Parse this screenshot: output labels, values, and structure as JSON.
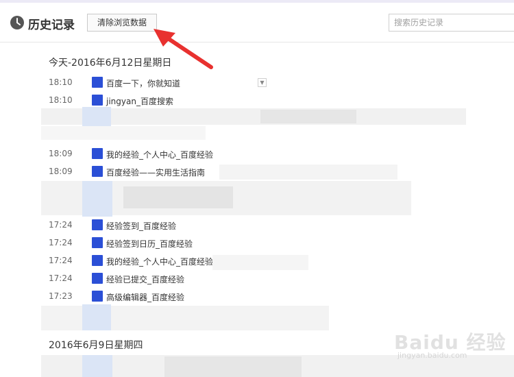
{
  "header": {
    "title": "历史记录",
    "clear_button_label": "清除浏览数据",
    "search_placeholder": "搜索历史记录"
  },
  "days": [
    {
      "heading": "今天-2016年6月12日星期日",
      "entries": [
        {
          "time": "18:10",
          "title": "百度一下，你就知道"
        },
        {
          "time": "18:10",
          "title": "jingyan_百度搜索"
        },
        {
          "time": "18:09",
          "title": "我的经验_个人中心_百度经验"
        },
        {
          "time": "18:09",
          "title": "百度经验——实用生活指南"
        },
        {
          "time": "17:24",
          "title": "经验签到_百度经验"
        },
        {
          "time": "17:24",
          "title": "经验签到日历_百度经验"
        },
        {
          "time": "17:24",
          "title": "我的经验_个人中心_百度经验"
        },
        {
          "time": "17:24",
          "title": "经验已提交_百度经验"
        },
        {
          "time": "17:23",
          "title": "高级编辑器_百度经验"
        }
      ]
    },
    {
      "heading": "2016年6月9日星期四",
      "entries": []
    }
  ],
  "watermark": {
    "logo": "Baidu 经验",
    "url": "jingyan.baidu.com"
  },
  "colors": {
    "favicon_blue": "#2b4fd6",
    "arrow_red": "#e8312f"
  },
  "icons": {
    "history": "clock-icon",
    "entry": "baidu-paw-icon"
  }
}
